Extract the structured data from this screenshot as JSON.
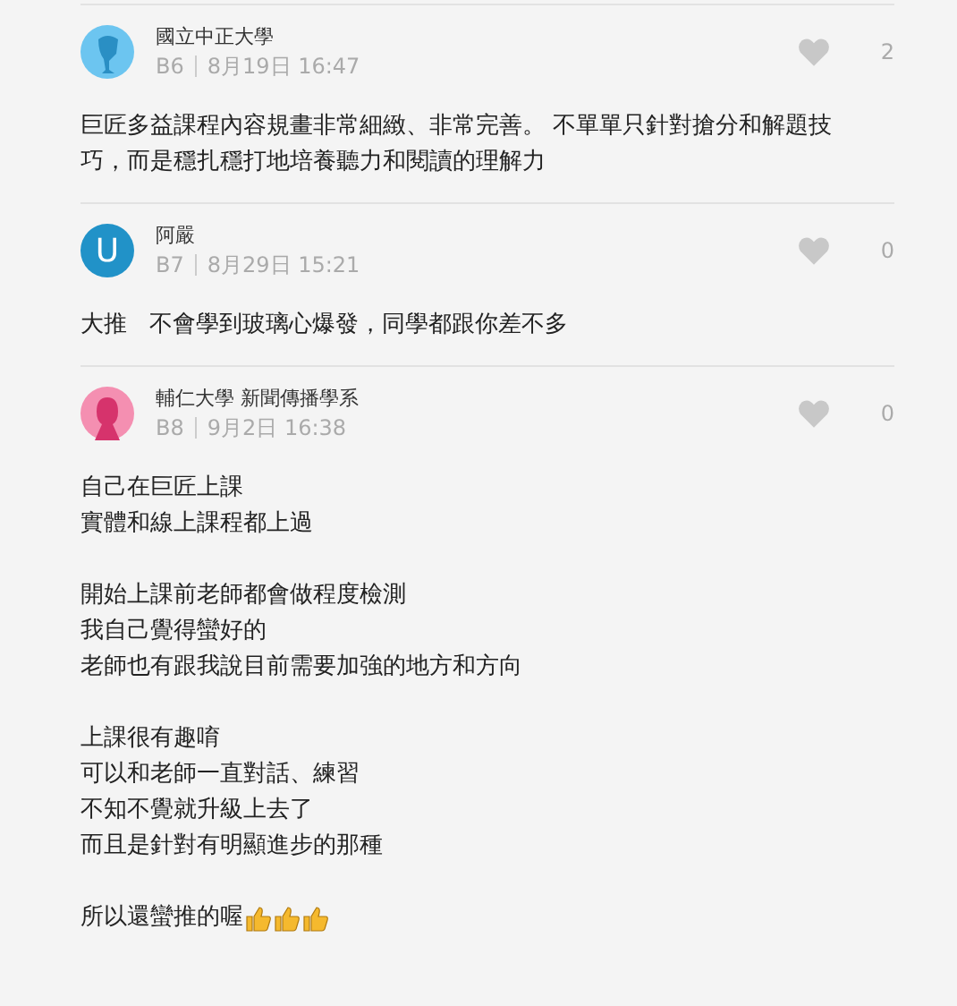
{
  "comments": [
    {
      "avatar": {
        "kind": "figure",
        "color": "#6cc5f0"
      },
      "author": "國立中正大學",
      "floor": "B6",
      "time": "8月19日 16:47",
      "likes": "2",
      "paragraphs": [
        {
          "lines": [
            "巨匠多益課程內容規畫非常細緻、非常完善。 不單單只針對搶分和解題技巧，而是穩扎穩打地培養聽力和閱讀的理解力"
          ]
        }
      ]
    },
    {
      "avatar": {
        "kind": "letter",
        "letter": "U",
        "color": "#2192c8"
      },
      "author": "阿嚴",
      "floor": "B7",
      "time": "8月29日 15:21",
      "likes": "0",
      "paragraphs": [
        {
          "lines": [
            "大推   不會學到玻璃心爆發，同學都跟你差不多"
          ]
        }
      ]
    },
    {
      "avatar": {
        "kind": "woman",
        "color": "#f48fb1"
      },
      "author": "輔仁大學 新聞傳播學系",
      "floor": "B8",
      "time": "9月2日 16:38",
      "likes": "0",
      "paragraphs": [
        {
          "lines": [
            "自己在巨匠上課",
            "實體和線上課程都上過"
          ]
        },
        {
          "lines": [
            "開始上課前老師都會做程度檢測",
            "我自己覺得蠻好的",
            "老師也有跟我說目前需要加強的地方和方向"
          ]
        },
        {
          "lines": [
            "上課很有趣唷",
            "可以和老師一直對話、練習",
            "不知不覺就升級上去了",
            "而且是針對有明顯進步的那種"
          ]
        },
        {
          "lines": [
            "所以還蠻推的喔"
          ],
          "trailing_icons": [
            {
              "kind": "thumbs-up"
            },
            {
              "kind": "thumbs-up"
            },
            {
              "kind": "thumbs-up"
            }
          ]
        }
      ]
    }
  ]
}
